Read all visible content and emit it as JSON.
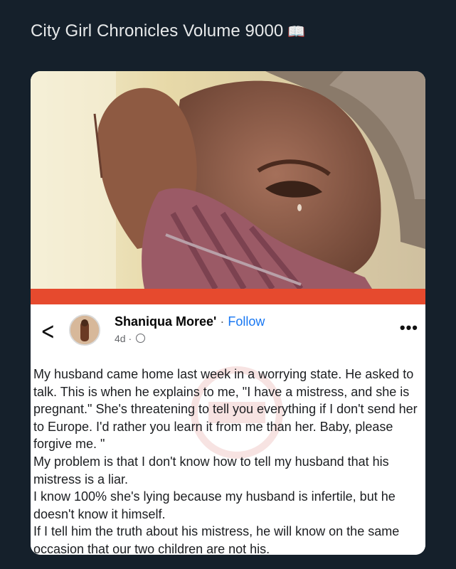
{
  "tweet": {
    "text": "City Girl Chronicles Volume 9000",
    "emoji": "📖"
  },
  "post": {
    "author": "Shaniqua Moree'",
    "separator": "·",
    "follow_label": "Follow",
    "time": "4d ·",
    "back_glyph": "<",
    "more_glyph": "•••",
    "paragraphs": [
      "My husband came home last week in a worrying state. He asked to talk. This is when he explains to me, \"I have a mistress, and she is pregnant.\" She's threatening to tell you everything if I don't send her to Europe. I'd rather you learn it from me than her. Baby, please forgive me. \"",
      "My problem is that I don't know how to tell my husband that his mistress is a liar.",
      "I know 100% she's lying because my husband is infertile, but he doesn't know it himself.",
      "If I tell him the truth about his mistress, he will know on the same occasion that our two children are not his."
    ]
  },
  "colors": {
    "background": "#15202b",
    "accent_bar": "#e64a2e",
    "follow_link": "#1877f2"
  },
  "icons": [
    "back-chevron-icon",
    "globe-icon",
    "more-options-icon",
    "open-book-icon"
  ]
}
